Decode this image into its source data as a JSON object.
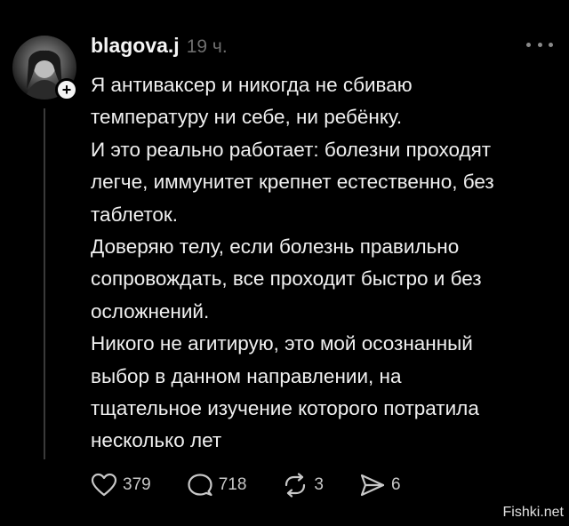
{
  "post": {
    "username": "blagova.j",
    "timestamp": "19 ч.",
    "text": "Я антиваксер и никогда не сбиваю\nтемпературу  ни себе, ни ребёнку.\nИ это реально работает: болезни проходят\nлегче, иммунитет крепнет естественно, без\nтаблеток.\nДоверяю телу, если болезнь правильно\nсопровождать, все проходит быстро и без\nосложнений.\nНикого не агитирую, это мой осознанный\nвыбор в данном направлении, на\nтщательное изучение которого потратила\nнесколько лет"
  },
  "actions": {
    "likes": "379",
    "replies": "718",
    "reposts": "3",
    "shares": "6"
  },
  "icons": {
    "like": "heart-icon",
    "reply": "speech-bubble-icon",
    "repost": "repost-arrows-icon",
    "share": "send-arrow-icon",
    "more": "more-dots-icon",
    "follow": "plus-icon"
  },
  "watermark": "Fishki.net",
  "colors": {
    "background": "#000000",
    "text": "#f0f0f0",
    "muted": "#6e6e6e",
    "thread_line": "#3a3a3a"
  }
}
